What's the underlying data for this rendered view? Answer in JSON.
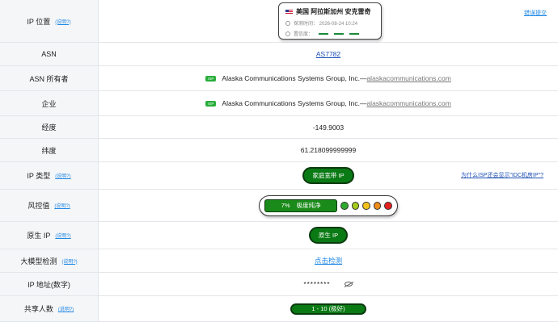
{
  "rows": {
    "ip_location": {
      "label": "IP 位置",
      "hint": "(说明?)",
      "flag": "us-flag-icon",
      "location": "美国 阿拉斯加州 安克雷奇",
      "detect_time": "探测时间：  2026-08-24 10:24",
      "confidence": "置信度：",
      "correction": "错误提交"
    },
    "asn": {
      "label": "ASN",
      "value": "AS7782"
    },
    "asn_owner": {
      "label": "ASN 所有者",
      "badge": "ISP",
      "org": "Alaska Communications Systems Group, Inc.—",
      "domain": "alaskacommunications.com"
    },
    "company": {
      "label": "企业",
      "badge": "ISP",
      "org": "Alaska Communications Systems Group, Inc.—",
      "domain": "alaskacommunications.com"
    },
    "longitude": {
      "label": "经度",
      "value": "-149.9003"
    },
    "latitude": {
      "label": "纬度",
      "value": "61.218099999999"
    },
    "ip_type": {
      "label": "IP 类型",
      "hint": "(说明?)",
      "value": "家庭宽带 IP",
      "why": "为什么ISP还会显示\"IDC机房IP\"?"
    },
    "risk": {
      "label": "风控值",
      "hint": "(说明?)",
      "percent": "7%",
      "text": "极度纯净",
      "score": 0.07
    },
    "native_ip": {
      "label": "原生 IP",
      "hint": "(说明?)",
      "value": "原生 IP"
    },
    "llm_check": {
      "label": "大模型检测",
      "hint": "(说明?)",
      "value": "点击检测"
    },
    "ip_numeric": {
      "label": "IP 地址(数字)",
      "value": "********"
    },
    "shared": {
      "label": "共享人数",
      "hint": "(说明?)",
      "value": "1 - 10 (极好)"
    }
  }
}
